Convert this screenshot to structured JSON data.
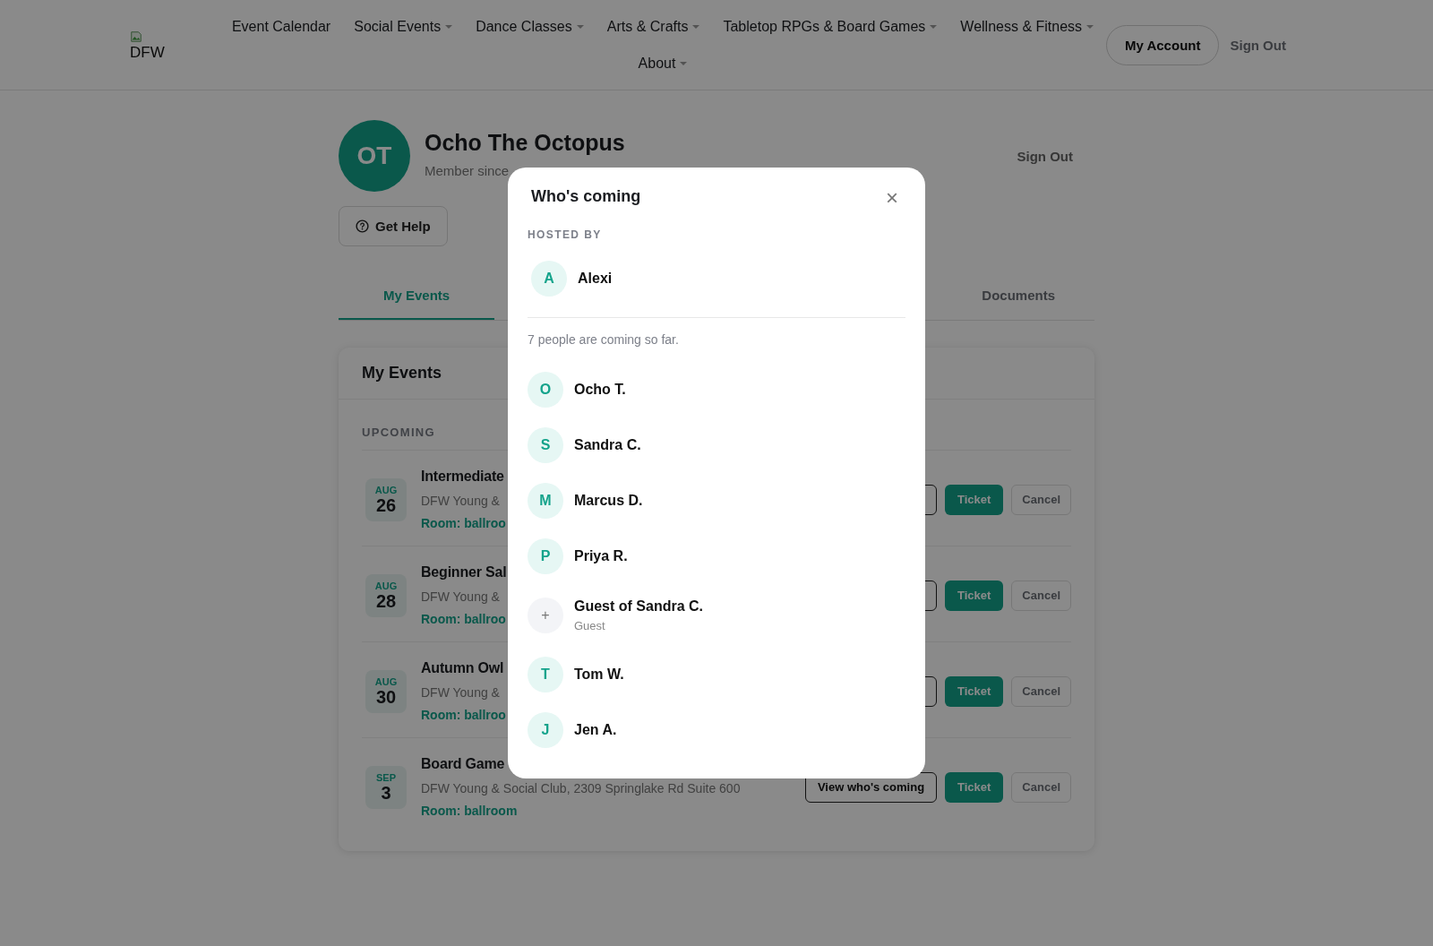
{
  "header": {
    "logo_text": "DFW",
    "nav": [
      {
        "label": "Event Calendar",
        "dropdown": false
      },
      {
        "label": "Social Events",
        "dropdown": true
      },
      {
        "label": "Dance Classes",
        "dropdown": true
      },
      {
        "label": "Arts & Crafts",
        "dropdown": true
      },
      {
        "label": "Tabletop RPGs & Board Games",
        "dropdown": true
      },
      {
        "label": "Wellness & Fitness",
        "dropdown": true
      },
      {
        "label": "About",
        "dropdown": true
      }
    ],
    "account_button": "My Account",
    "sign_out": "Sign Out"
  },
  "profile": {
    "initials": "OT",
    "name": "Ocho The Octopus",
    "member_since": "Member since",
    "sign_out": "Sign Out",
    "help_button": "Get Help"
  },
  "tabs": [
    {
      "label": "My Events",
      "selected": true
    },
    {
      "label": "Documents",
      "selected": false
    }
  ],
  "events_card": {
    "title": "My Events",
    "section": "UPCOMING",
    "events": [
      {
        "month": "AUG",
        "day": "26",
        "title": "Intermediate",
        "address": "DFW Young &",
        "room": "Room: ballroo",
        "ticket_button": "Ticket",
        "cancel_button": "Cancel"
      },
      {
        "month": "AUG",
        "day": "28",
        "title": "Beginner Sal",
        "address": "DFW Young &",
        "room": "Room: ballroo",
        "ticket_button": "Ticket",
        "cancel_button": "Cancel"
      },
      {
        "month": "AUG",
        "day": "30",
        "title": "Autumn Owl",
        "address": "DFW Young &",
        "room": "Room: ballroo",
        "ticket_button": "Ticket",
        "cancel_button": "Cancel"
      },
      {
        "month": "SEP",
        "day": "3",
        "title": "Board Game",
        "address": "DFW Young & Social Club, 2309 Springlake Rd Suite 600",
        "room": "Room: ballroom",
        "view_button": "View who's coming",
        "ticket_button": "Ticket",
        "cancel_button": "Cancel"
      }
    ]
  },
  "modal": {
    "title": "Who's coming",
    "close": "×",
    "hosted_label": "HOSTED BY",
    "host": {
      "initial": "A",
      "name": "Alexi"
    },
    "count_text": "7 people are coming so far.",
    "attendees": [
      {
        "kind": "member",
        "initial": "O",
        "name": "Ocho T."
      },
      {
        "kind": "member",
        "initial": "S",
        "name": "Sandra C."
      },
      {
        "kind": "member",
        "initial": "M",
        "name": "Marcus D."
      },
      {
        "kind": "member",
        "initial": "P",
        "name": "Priya R."
      },
      {
        "kind": "guest",
        "initial": "+",
        "name": "Guest of Sandra C.",
        "note": "Guest"
      },
      {
        "kind": "member",
        "initial": "T",
        "name": "Tom W."
      },
      {
        "kind": "member",
        "initial": "J",
        "name": "Jen A."
      }
    ]
  }
}
